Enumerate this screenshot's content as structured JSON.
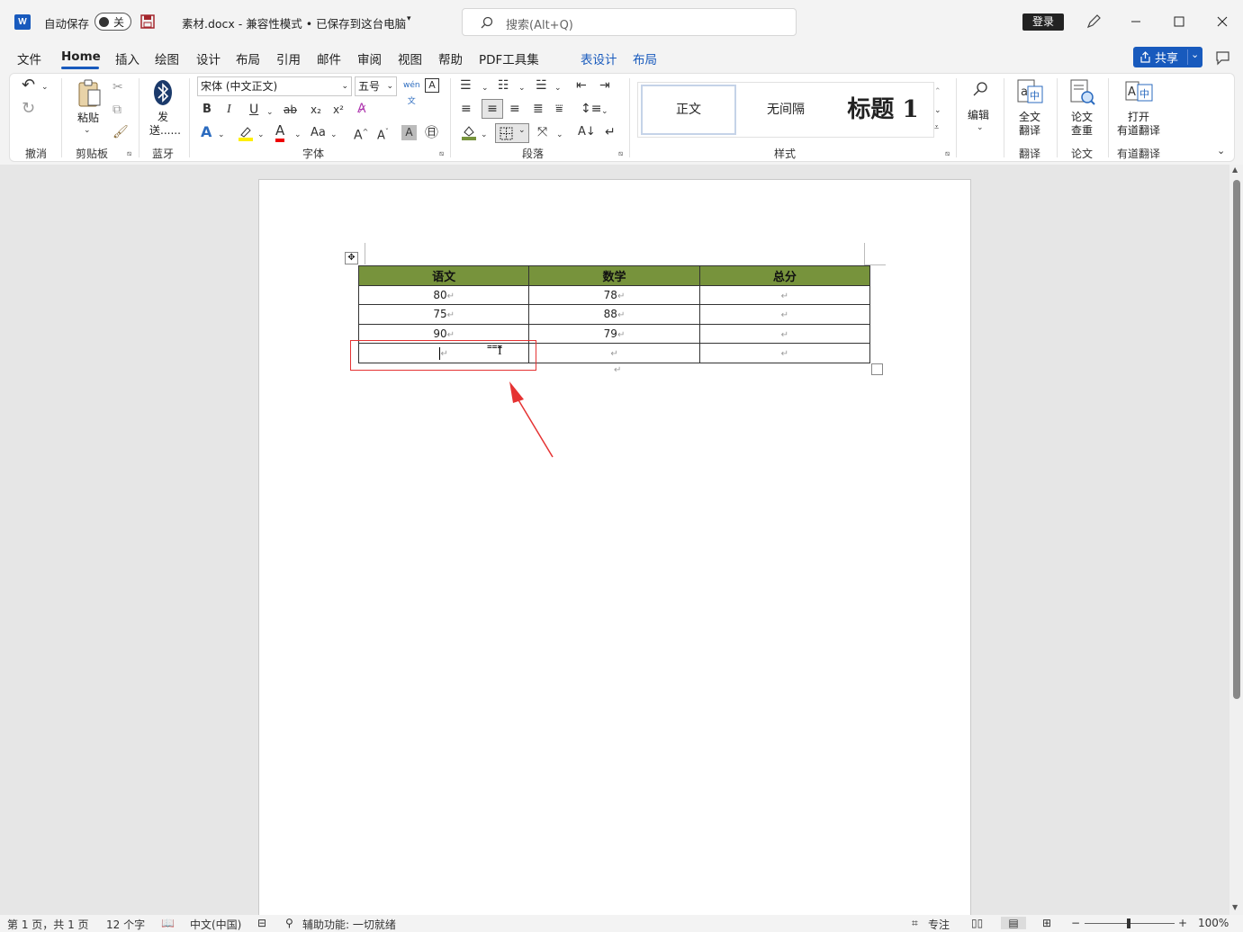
{
  "titlebar": {
    "autosave_label": "自动保存",
    "autosave_state": "关",
    "doc_title": "素材.docx  -  兼容性模式 • 已保存到这台电脑",
    "search_placeholder": "搜索(Alt+Q)",
    "login": "登录"
  },
  "menu": {
    "items": [
      "文件",
      "Home",
      "插入",
      "绘图",
      "设计",
      "布局",
      "引用",
      "邮件",
      "审阅",
      "视图",
      "帮助",
      "PDF工具集",
      "表设计",
      "布局"
    ],
    "share": "共享"
  },
  "ribbon": {
    "groups": {
      "undo": "撤消",
      "clipboard": "剪贴板",
      "bluetooth": "蓝牙",
      "font": "字体",
      "paragraph": "段落",
      "styles": "样式",
      "translate": "翻译",
      "paper": "论文",
      "youdao": "有道翻译"
    },
    "paste": "粘贴",
    "send_line1": "发",
    "send_line2": "送......",
    "font_name": "宋体 (中文正文)",
    "font_size": "五号",
    "styles": [
      "正文",
      "无间隔",
      "标题 1"
    ],
    "edit": "编辑",
    "full_translate_1": "全文",
    "full_translate_2": "翻译",
    "paper_check_1": "论文",
    "paper_check_2": "查重",
    "open_youdao_1": "打开",
    "open_youdao_2": "有道翻译"
  },
  "table": {
    "headers": [
      "语文",
      "数学",
      "总分"
    ],
    "rows": [
      [
        "80",
        "78",
        ""
      ],
      [
        "75",
        "88",
        ""
      ],
      [
        "90",
        "79",
        ""
      ],
      [
        "",
        "",
        ""
      ]
    ]
  },
  "statusbar": {
    "page": "第 1 页，共 1 页",
    "words": "12 个字",
    "language": "中文(中国)",
    "accessibility": "辅助功能: 一切就绪",
    "focus": "专注",
    "zoom": "100%"
  }
}
